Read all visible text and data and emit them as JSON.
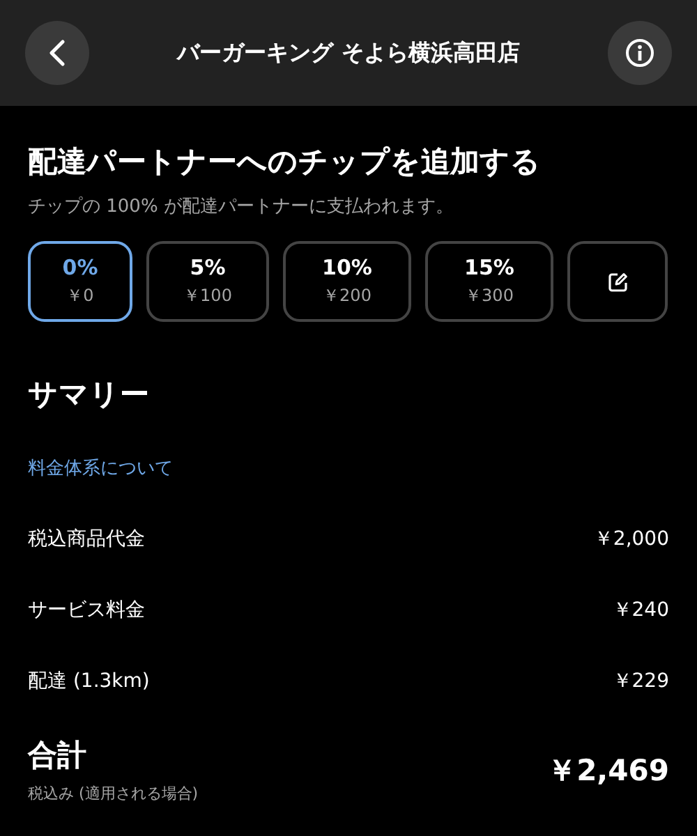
{
  "header": {
    "title": "バーガーキング そよら横浜高田店"
  },
  "tip": {
    "title": "配達パートナーへのチップを追加する",
    "subtitle": "チップの 100% が配達パートナーに支払われます。",
    "options": [
      {
        "kind": "percent",
        "percent": "0%",
        "amount": "￥0",
        "selected": true
      },
      {
        "kind": "percent",
        "percent": "5%",
        "amount": "￥100",
        "selected": false
      },
      {
        "kind": "percent",
        "percent": "10%",
        "amount": "￥200",
        "selected": false
      },
      {
        "kind": "percent",
        "percent": "15%",
        "amount": "￥300",
        "selected": false
      },
      {
        "kind": "custom",
        "selected": false
      }
    ]
  },
  "summary": {
    "title": "サマリー",
    "link": "料金体系について",
    "rows": [
      {
        "label": "税込商品代金",
        "value": "￥2,000"
      },
      {
        "label": "サービス料金",
        "value": "￥240"
      },
      {
        "label": "配達 (1.3km)",
        "value": "￥229"
      }
    ]
  },
  "total": {
    "label": "合計",
    "note": "税込み (適用される場合)",
    "value": "￥2,469"
  }
}
